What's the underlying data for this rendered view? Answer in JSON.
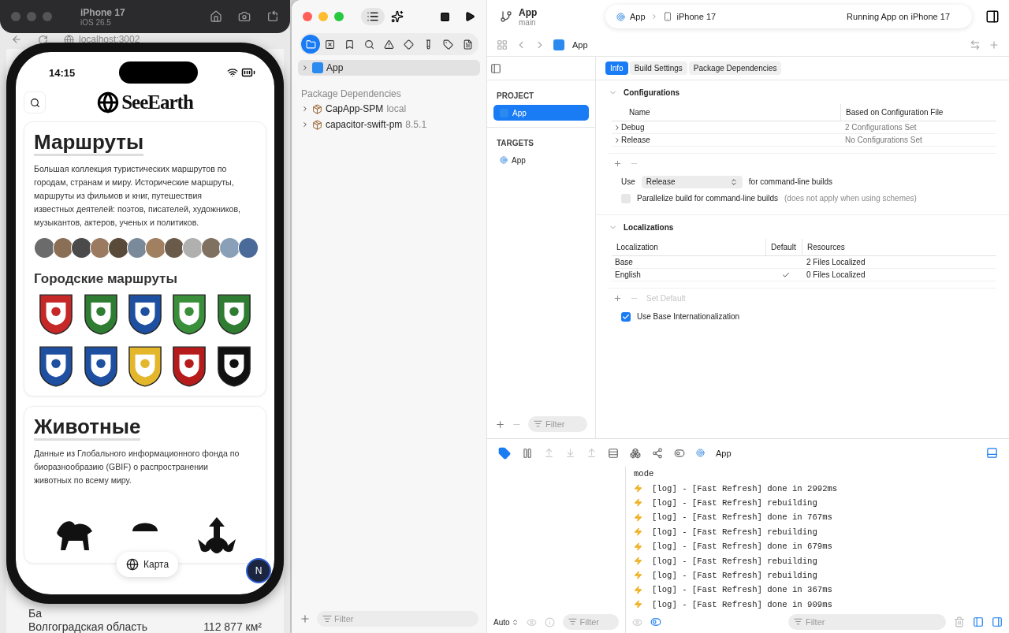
{
  "simulator": {
    "device": "iPhone 17",
    "os": "iOS 26.5",
    "url": "localhost:3002"
  },
  "behind_page": {
    "rows": [
      {
        "label": "Ба",
        "value": ""
      },
      {
        "label": "Волгоградская область",
        "value": "112 877 км²"
      }
    ]
  },
  "phone": {
    "time": "14:15",
    "app_title": "SeeEarth",
    "map_button": "Карта",
    "user_initial": "N",
    "routes": {
      "title": "Маршруты",
      "text": "Большая коллекция туристических маршрутов по городам, странам и миру. Исторические маршруты, маршруты из фильмов и книг, путешествия известных деятелей: поэтов, писателей, художников, музыкантов, актеров, ученых и политиков.",
      "subtitle": "Городские маршруты",
      "coats": [
        {
          "color": "#c62828"
        },
        {
          "color": "#2e7d32"
        },
        {
          "color": "#1e4fa0"
        },
        {
          "color": "#3a8f3a"
        },
        {
          "color": "#2e7d32"
        },
        {
          "color": "#1e4fa0"
        },
        {
          "color": "#1e4fa0"
        },
        {
          "color": "#e3b62c"
        },
        {
          "color": "#b71c1c"
        },
        {
          "color": "#111111"
        }
      ]
    },
    "animals": {
      "title": "Животные",
      "text": "Данные из Глобального информационного фонда по биоразнообразию (GBIF) о распространении животных по всему миру."
    }
  },
  "navigator": {
    "tabs": [
      {
        "selected": true
      },
      {
        "selected": false
      },
      {
        "selected": false
      },
      {
        "selected": false
      },
      {
        "selected": false
      },
      {
        "selected": false
      },
      {
        "selected": false
      },
      {
        "selected": false
      },
      {
        "selected": false
      }
    ],
    "root": {
      "label": "App",
      "selected": true,
      "expanded": false
    },
    "section": "Package Dependencies",
    "packages": [
      {
        "name": "CapApp-SPM",
        "detail": "local",
        "expanded": false
      },
      {
        "name": "capacitor-swift-pm",
        "detail": "8.5.1",
        "expanded": false
      }
    ],
    "filter": {
      "placeholder": "Filter"
    }
  },
  "toolbar": {
    "project": "App",
    "branch": "main",
    "scheme": "App",
    "device": "iPhone 17",
    "status": "Running App on iPhone 17"
  },
  "jump_bar": {
    "item": "App"
  },
  "sidebar": {
    "groups": [
      {
        "title": "PROJECT",
        "items": [
          {
            "label": "App",
            "selected": true
          }
        ]
      },
      {
        "title": "TARGETS",
        "items": [
          {
            "label": "App",
            "selected": false
          }
        ]
      }
    ],
    "filter": {
      "placeholder": "Filter"
    }
  },
  "tabs": [
    {
      "label": "Info",
      "selected": true
    },
    {
      "label": "Build Settings",
      "selected": false
    },
    {
      "label": "Package Dependencies",
      "selected": false
    }
  ],
  "configurations": {
    "title": "Configurations",
    "columns": [
      "Name",
      "Based on Configuration File"
    ],
    "rows": [
      {
        "name": "Debug",
        "file": "2 Configurations Set",
        "expanded": false
      },
      {
        "name": "Release",
        "file": "No Configurations Set",
        "expanded": false
      }
    ],
    "use_label": "Use",
    "use_value": "Release",
    "use_suffix": "for command-line builds",
    "parallelize": {
      "label": "Parallelize build for command-line builds",
      "note": "(does not apply when using schemes)",
      "checked": false
    }
  },
  "localizations": {
    "title": "Localizations",
    "columns": [
      "Localization",
      "Default",
      "Resources"
    ],
    "rows": [
      {
        "name": "Base",
        "default": false,
        "resources": "2 Files Localized"
      },
      {
        "name": "English",
        "default": true,
        "resources": "0 Files Localized"
      }
    ],
    "set_default": {
      "label": "Set Default",
      "disabled": true
    },
    "base_internationalization": {
      "label": "Use Base Internationalization",
      "checked": true
    }
  },
  "debug": {
    "process": "App",
    "variables_scope": "Auto",
    "variables_filter": {
      "placeholder": "Filter"
    },
    "console_filter": {
      "placeholder": "Filter"
    },
    "lines": [
      {
        "kind": "plain",
        "text": "mode"
      },
      {
        "kind": "log",
        "text": "[log] - [Fast Refresh] done in 2992ms"
      },
      {
        "kind": "log",
        "text": "[log] - [Fast Refresh] rebuilding"
      },
      {
        "kind": "log",
        "text": "[log] - [Fast Refresh] done in 767ms"
      },
      {
        "kind": "log",
        "text": "[log] - [Fast Refresh] rebuilding"
      },
      {
        "kind": "log",
        "text": "[log] - [Fast Refresh] done in 679ms"
      },
      {
        "kind": "log",
        "text": "[log] - [Fast Refresh] rebuilding"
      },
      {
        "kind": "log",
        "text": "[log] - [Fast Refresh] rebuilding"
      },
      {
        "kind": "log",
        "text": "[log] - [Fast Refresh] done in 367ms"
      },
      {
        "kind": "log",
        "text": "[log] - [Fast Refresh] done in 909ms"
      }
    ]
  }
}
